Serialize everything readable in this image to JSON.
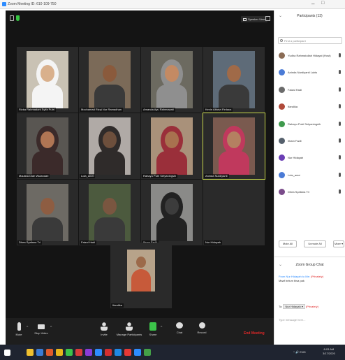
{
  "window": {
    "title": "Zoom Meeting ID: 610-109-750",
    "minimize": "–",
    "maximize": "□"
  },
  "meeting": {
    "speaker_view_label": "Speaker View",
    "tiles": [
      {
        "name": "Rizka Rahmadani Syifa Putri",
        "skin": "#d9b08c",
        "bg": "#c9c2b4",
        "hijab": "#f4f4f4"
      },
      {
        "name": "Mochamad Rizqi Nur Ramadhan",
        "skin": "#8a5a3c",
        "bg": "#7b6a58",
        "hijab": ""
      },
      {
        "name": "Amanda Ayu Rahmawati",
        "skin": "#c48a63",
        "bg": "#6c6a60",
        "hijab": "#8f8f8f"
      },
      {
        "name": "Kevin Alfarizi Firdaus",
        "skin": "#a06a48",
        "bg": "#5e6b78",
        "hijab": ""
      },
      {
        "name": "Maulida Diah Wulandari",
        "skin": "#b07554",
        "bg": "#595652",
        "hijab": "#3b2a2a"
      },
      {
        "name": "Lola_amel",
        "skin": "#6d4f3c",
        "bg": "#b0aaa6",
        "hijab": "#2f2b2a"
      },
      {
        "name": "Rahayu Putri Setyaningsih",
        "skin": "#a8714f",
        "bg": "#a9917a",
        "hijab": "#9a2f3a"
      },
      {
        "name": "Aninda Nurdiyanti",
        "skin": "#b48061",
        "bg": "#7a5a4f",
        "hijab": "#c0395d"
      },
      {
        "name": "Dhea Syafana Tri",
        "skin": "#8e5d42",
        "bg": "#6d6a64",
        "hijab": ""
      },
      {
        "name": "Faizal Hadi",
        "skin": "#7a5640",
        "bg": "#4c5a3e",
        "hijab": ""
      },
      {
        "name": "Ilham Fadli",
        "skin": "#3c3c3c",
        "bg": "#8a8a88",
        "hijab": "#222"
      },
      {
        "name": "Nur Hidayah",
        "skin": "",
        "bg": "#141414",
        "hijab": ""
      }
    ],
    "center_tile": {
      "name": "Ifandika"
    },
    "toolbar": {
      "mute": "Mute",
      "stop_video": "Stop Video",
      "invite": "Invite",
      "manage_participants": "Manage Participants",
      "share": "Share",
      "chat": "Chat",
      "record": "Record",
      "end_meeting": "End Meeting"
    }
  },
  "participants_panel": {
    "title": "Participants (13)",
    "search_placeholder": "Find a participant",
    "list": [
      {
        "name": "Yudha Rahmatullah Hidayat (Host)",
        "color": "#8b6c55"
      },
      {
        "name": "Aninda Nurdiyanti Lubis",
        "color": "#4b7bd6"
      },
      {
        "name": "Faizal Hadi",
        "color": "#6b6b6b"
      },
      {
        "name": "Ifandika",
        "color": "#b04a3a"
      },
      {
        "name": "Rahayu Putri Setyaningsih",
        "color": "#3f9a4d"
      },
      {
        "name": "Ilham Fadli",
        "color": "#55606c"
      },
      {
        "name": "Nur Hidayah",
        "color": "#6b3fb5"
      },
      {
        "name": "Lola_amel",
        "color": "#4b7bd6"
      },
      {
        "name": "Dhea Syafana Tri",
        "color": "#7a4b8a"
      }
    ],
    "mute_all": "Mute All",
    "unmute_all": "Unmute All",
    "more": "More ▾"
  },
  "chat": {
    "title": "Zoom Group Chat",
    "message_from": "From Nur Hidayah to Me:",
    "message_private": "(Privately)",
    "message_text": "Maaf belum bisa pak",
    "to_label": "To:",
    "to_value": "Nur Hidayah ▾",
    "to_private": "(Privately)",
    "input_placeholder": "Type message here..."
  },
  "taskbar": {
    "tray_text": "^ 🔊 ENG",
    "time": "8:03 AM",
    "date": "3/17/2020",
    "icons": [
      "#f0c02f",
      "#3a7bd5",
      "#e05a2b",
      "#e8b61b",
      "#3cc34a",
      "#d93b3b",
      "#8a3bd9",
      "#2d8cff",
      "#d32f2f",
      "#1e88e5",
      "#e53935",
      "#2d8cff",
      "#43a047"
    ]
  }
}
